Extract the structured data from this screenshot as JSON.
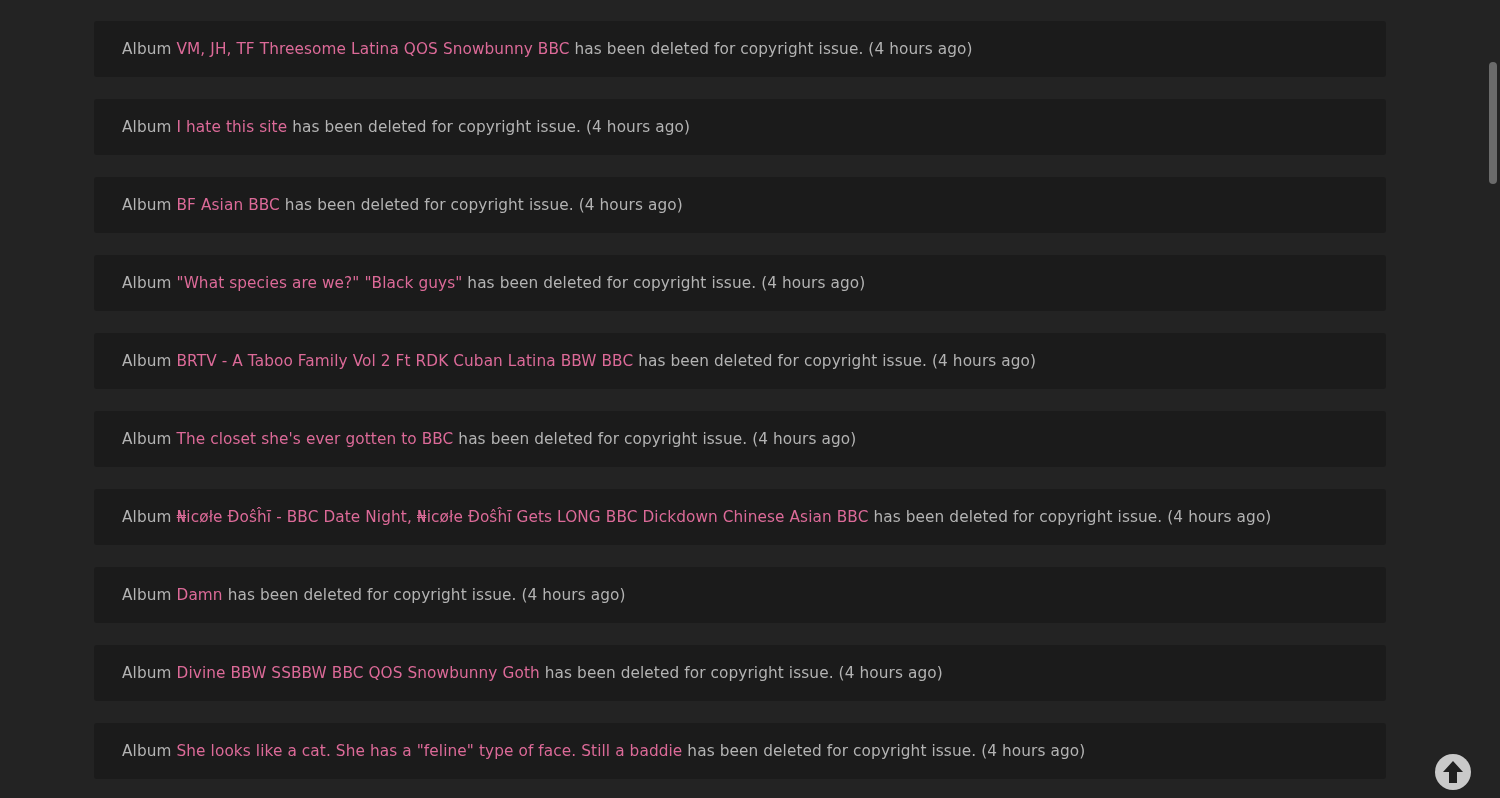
{
  "notifications": [
    {
      "label": "Album",
      "title": "VM, JH, TF Threesome Latina QOS Snowbunny BBC",
      "message": "has been deleted for copyright issue.",
      "time": "(4 hours ago)"
    },
    {
      "label": "Album",
      "title": "I hate this site",
      "message": "has been deleted for copyright issue.",
      "time": "(4 hours ago)"
    },
    {
      "label": "Album",
      "title": "BF Asian BBC",
      "message": "has been deleted for copyright issue.",
      "time": "(4 hours ago)"
    },
    {
      "label": "Album",
      "title": "\"What species are we?\" \"Black guys\"",
      "message": "has been deleted for copyright issue.",
      "time": "(4 hours ago)"
    },
    {
      "label": "Album",
      "title": "BRTV - A Taboo Family Vol 2 Ft RDK Cuban Latina BBW BBC",
      "message": "has been deleted for copyright issue.",
      "time": "(4 hours ago)"
    },
    {
      "label": "Album",
      "title": "The closet she's ever gotten to BBC",
      "message": "has been deleted for copyright issue.",
      "time": "(4 hours ago)"
    },
    {
      "label": "Album",
      "title": "₦icøłe Đoŝĥī - BBC Date Night, ₦icøłe Đoŝĥī Gets LONG BBC Dickdown Chinese Asian BBC",
      "message": "has been deleted for copyright issue.",
      "time": "(4 hours ago)"
    },
    {
      "label": "Album",
      "title": "Damn",
      "message": "has been deleted for copyright issue.",
      "time": "(4 hours ago)"
    },
    {
      "label": "Album",
      "title": "Divine BBW SSBBW BBC QOS Snowbunny Goth",
      "message": "has been deleted for copyright issue.",
      "time": "(4 hours ago)"
    },
    {
      "label": "Album",
      "title": "She looks like a cat. She has a \"feline\" type of face. Still a baddie",
      "message": "has been deleted for copyright issue.",
      "time": "(4 hours ago)"
    }
  ]
}
